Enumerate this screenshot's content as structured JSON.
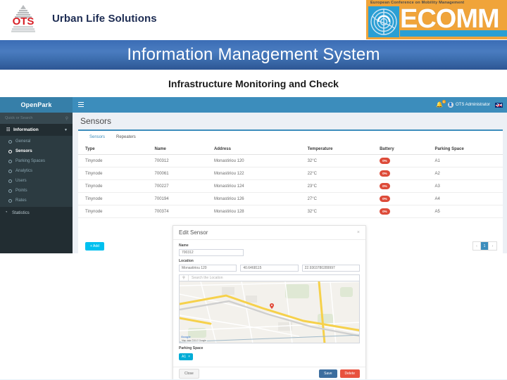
{
  "slide": {
    "brand_title": "Urban Life Solutions",
    "logo_text": "OTS",
    "banner": {
      "tagline": "European Conference on Mobility Management",
      "word_prefix": "EC",
      "word_suffix": "OMM"
    },
    "title": "Information Management System",
    "subtitle": "Infrastructure Monitoring and Check"
  },
  "app": {
    "sidebar": {
      "brand": "OpenPark",
      "search_placeholder": "Quick or Search",
      "search_icon": "search-icon",
      "group": {
        "label": "Information",
        "icon": "dashboard-icon",
        "chevron": "chevron-down-icon"
      },
      "items": [
        {
          "label": "General",
          "active": false
        },
        {
          "label": "Sensors",
          "active": true
        },
        {
          "label": "Parking Spaces",
          "active": false
        },
        {
          "label": "Analytics",
          "active": false
        },
        {
          "label": "Users",
          "active": false
        },
        {
          "label": "Points",
          "active": false
        },
        {
          "label": "Rates",
          "active": false
        }
      ],
      "footer_item": {
        "label": "Statistics",
        "icon": "pie-chart-icon"
      }
    },
    "topbar": {
      "menu_icon": "hamburger-icon",
      "bell_icon": "bell-icon",
      "bell_badge": "4",
      "user_name": "OTS Administrator",
      "avatar_icon": "user-avatar-icon",
      "language_icon": "uk-flag-icon"
    },
    "page_title": "Sensors",
    "tabs": [
      {
        "label": "Sensors",
        "active": true
      },
      {
        "label": "Repeaters",
        "active": false
      }
    ],
    "table": {
      "columns": [
        "Type",
        "Name",
        "Address",
        "Temperature",
        "Battery",
        "Parking Space"
      ],
      "rows": [
        {
          "type": "Tinynode",
          "name": "700312",
          "address": "Monastiriou 120",
          "temperature": "32°C",
          "battery": "0%",
          "space": "A1"
        },
        {
          "type": "Tinynode",
          "name": "700061",
          "address": "Monastiriou 122",
          "temperature": "22°C",
          "battery": "0%",
          "space": "A2"
        },
        {
          "type": "Tinynode",
          "name": "700227",
          "address": "Monastiriou 124",
          "temperature": "23°C",
          "battery": "0%",
          "space": "A3"
        },
        {
          "type": "Tinynode",
          "name": "700194",
          "address": "Monastiriou 126",
          "temperature": "27°C",
          "battery": "0%",
          "space": "A4"
        },
        {
          "type": "Tinynode",
          "name": "700374",
          "address": "Monastiriou 128",
          "temperature": "32°C",
          "battery": "0%",
          "space": "A5"
        }
      ]
    },
    "add_button": "+ Add",
    "pagination": {
      "prev": "‹",
      "current": "1",
      "next": "›"
    }
  },
  "modal": {
    "title": "Edit Sensor",
    "close_icon": "close-icon",
    "name_label": "Name",
    "name_value": "700312",
    "location_label": "Location",
    "address_value": "Monastiriou 120",
    "latitude_value": "40.6468115",
    "longitude_value": "22.9303780289997",
    "search_placeholder": "Search the Location",
    "search_icon": "search-icon",
    "map_marker_icon": "map-pin-icon",
    "map_attribution": "Map data ©2017 Google",
    "map_logo": "Google",
    "parking_space_label": "Parking Space",
    "parking_space_tag": "A1",
    "parking_space_tag_remove": "×",
    "close_button": "Close",
    "save_button": "Save",
    "delete_button": "Delete"
  },
  "colors": {
    "title_band": "#3b6db5",
    "sidebar": "#222d32",
    "topbar": "#3c8dbc",
    "accent": "#00c0ef",
    "danger": "#dd4b39",
    "banner": "#f0a43a"
  }
}
